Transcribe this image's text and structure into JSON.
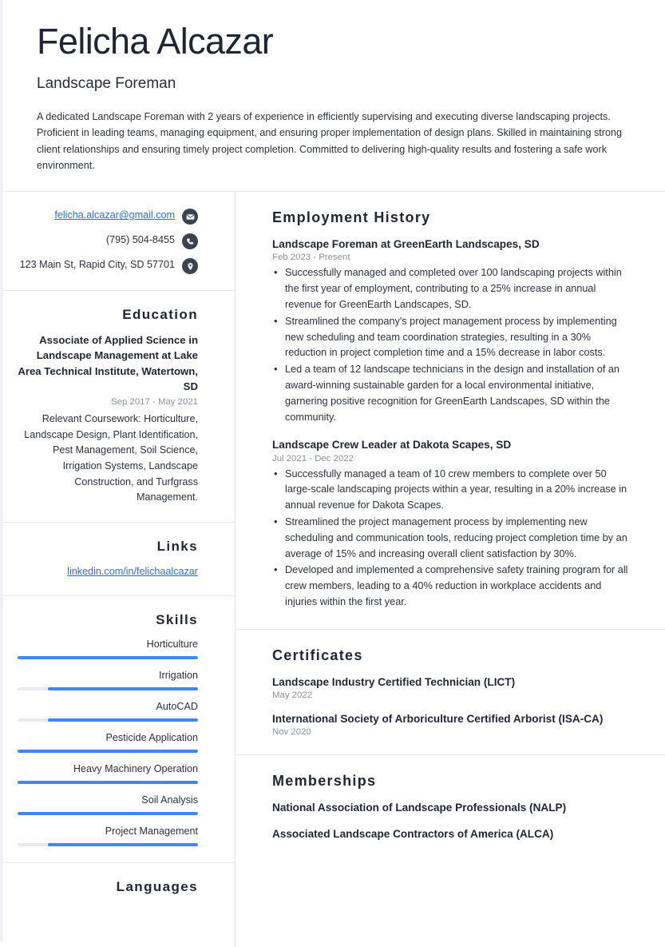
{
  "header": {
    "full_name": "Felicha Alcazar",
    "job_title": "Landscape Foreman",
    "summary": "A dedicated Landscape Foreman with 2 years of experience in efficiently supervising and executing diverse landscaping projects. Proficient in leading teams, managing equipment, and ensuring proper implementation of design plans. Skilled in maintaining strong client relationships and ensuring timely project completion. Committed to delivering high-quality results and fostering a safe work environment."
  },
  "sidebar": {
    "contact": {
      "email": "felicha.alcazar@gmail.com",
      "phone": "(795) 504-8455",
      "address": "123 Main St, Rapid City, SD 57701",
      "email_icon": "envelope-icon",
      "phone_icon": "phone-icon",
      "address_icon": "location-pin-icon"
    },
    "education": {
      "heading": "Education",
      "degree": "Associate of Applied Science in Landscape Management at Lake Area Technical Institute, Watertown, SD",
      "date": "Sep 2017 - May 2021",
      "description": "Relevant Coursework: Horticulture, Landscape Design, Plant Identification, Pest Management, Soil Science, Irrigation Systems, Landscape Construction, and Turfgrass Management."
    },
    "links": {
      "heading": "Links",
      "items": [
        {
          "label": "linkedin.com/in/felichaalcazar"
        }
      ]
    },
    "skills": {
      "heading": "Skills",
      "items": [
        {
          "name": "Horticulture",
          "level": 100
        },
        {
          "name": "Irrigation",
          "level": 83
        },
        {
          "name": "AutoCAD",
          "level": 83
        },
        {
          "name": "Pesticide Application",
          "level": 100
        },
        {
          "name": "Heavy Machinery Operation",
          "level": 100
        },
        {
          "name": "Soil Analysis",
          "level": 100
        },
        {
          "name": "Project Management",
          "level": 83
        }
      ]
    },
    "languages": {
      "heading": "Languages"
    }
  },
  "main": {
    "employment": {
      "heading": "Employment History",
      "entries": [
        {
          "title": "Landscape Foreman at GreenEarth Landscapes, SD",
          "date": "Feb 2023 - Present",
          "bullets": [
            "Successfully managed and completed over 100 landscaping projects within the first year of employment, contributing to a 25% increase in annual revenue for GreenEarth Landscapes, SD.",
            "Streamlined the company's project management process by implementing new scheduling and team coordination strategies, resulting in a 30% reduction in project completion time and a 15% decrease in labor costs.",
            "Led a team of 12 landscape technicians in the design and installation of an award-winning sustainable garden for a local environmental initiative, garnering positive recognition for GreenEarth Landscapes, SD within the community."
          ]
        },
        {
          "title": "Landscape Crew Leader at Dakota Scapes, SD",
          "date": "Jul 2021 - Dec 2022",
          "bullets": [
            "Successfully managed a team of 10 crew members to complete over 50 large-scale landscaping projects within a year, resulting in a 20% increase in annual revenue for Dakota Scapes.",
            "Streamlined the project management process by implementing new scheduling and communication tools, reducing project completion time by an average of 15% and increasing overall client satisfaction by 30%.",
            "Developed and implemented a comprehensive safety training program for all crew members, leading to a 40% reduction in workplace accidents and injuries within the first year."
          ]
        }
      ]
    },
    "certificates": {
      "heading": "Certificates",
      "entries": [
        {
          "title": "Landscape Industry Certified Technician (LICT)",
          "date": "May 2022"
        },
        {
          "title": "International Society of Arboriculture Certified Arborist (ISA-CA)",
          "date": "Nov 2020"
        }
      ]
    },
    "memberships": {
      "heading": "Memberships",
      "entries": [
        {
          "title": "National Association of Landscape Professionals (NALP)"
        },
        {
          "title": "Associated Landscape Contractors of America (ALCA)"
        }
      ]
    }
  },
  "colors": {
    "accent_blue": "#4285f4",
    "link_blue": "#2d6fd6",
    "text_dark": "#1f2533",
    "text_muted": "#8b8f99",
    "icon_bg": "#3d4251",
    "divider": "#e6e6e9"
  }
}
